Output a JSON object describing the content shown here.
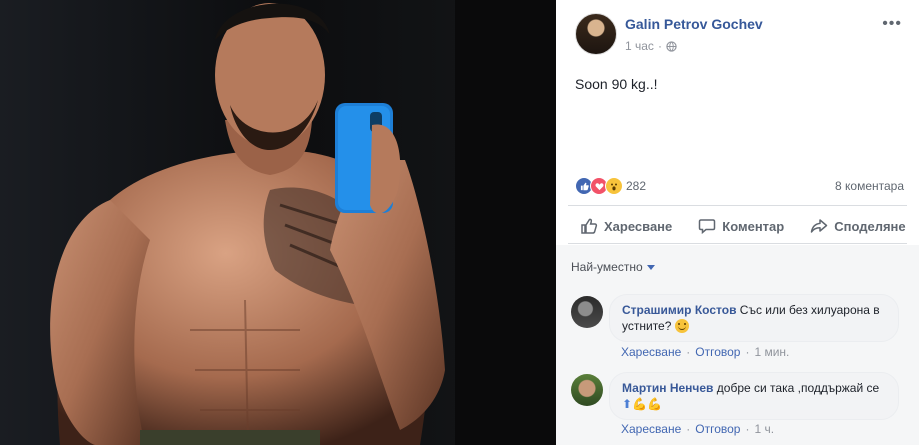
{
  "post": {
    "author": "Galin Petrov Gochev",
    "time": "1 час",
    "text": "Soon 90 kg..!",
    "reaction_count": "282",
    "comment_count": "8 коментара",
    "icons": [
      "like-icon",
      "love-icon",
      "wow-icon"
    ]
  },
  "actions": {
    "like": "Харесване",
    "comment": "Коментар",
    "share": "Споделяне"
  },
  "comments_section": {
    "sort_label": "Най-уместно",
    "comments": [
      {
        "author": "Страшимир Костов",
        "text": "Със или без хилуарона в устните?",
        "emoji": "smile-emoji",
        "like": "Харесване",
        "reply": "Отговор",
        "time": "1 мин."
      },
      {
        "author": "Мартин Ненчев",
        "text": "добре си така ,поддържай се",
        "emoji": [
          "up-arrow-emoji",
          "flexed-biceps-emoji",
          "flexed-biceps-emoji"
        ],
        "like": "Харесване",
        "reply": "Отговор",
        "time": "1 ч."
      }
    ]
  },
  "colors": {
    "brand_blue": "#4267b2",
    "author_link": "#365899",
    "muted": "#90949c",
    "photo_bg": "#0b0b0c"
  }
}
